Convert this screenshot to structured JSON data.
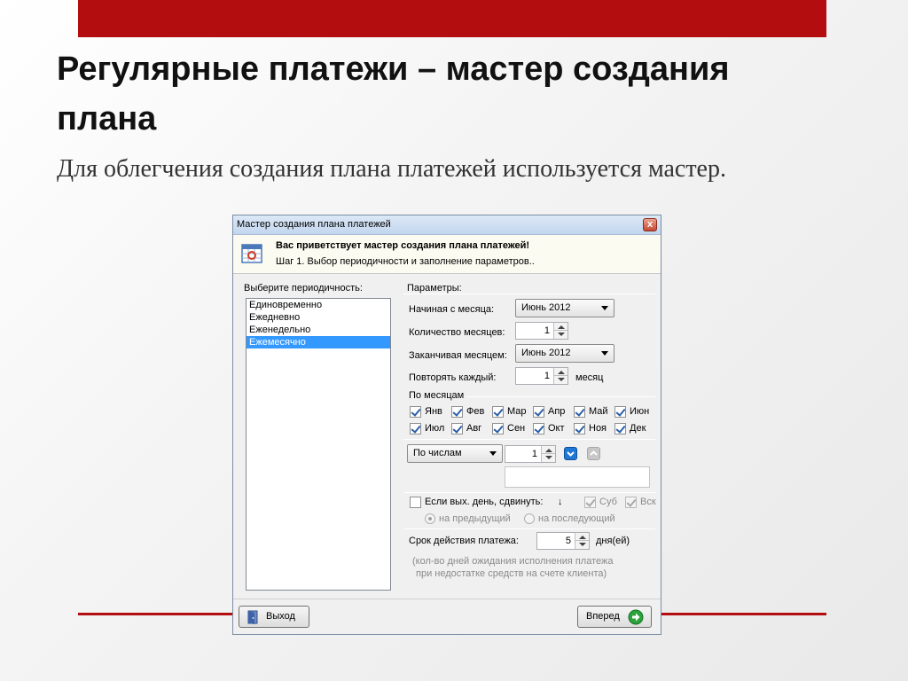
{
  "slide": {
    "title": "Регулярные платежи – мастер создания плана",
    "text": "Для облегчения создания плана платежей используется мастер."
  },
  "dialog": {
    "title": "Мастер создания плана платежей",
    "close_symbol": "x",
    "header_icon": "calendar-icon",
    "header_title": "Вас приветствует мастер создания плана платежей!",
    "header_subtitle": "Шаг 1. Выбор периодичности и заполнение параметров..",
    "periodicity_label": "Выберите периодичность:",
    "periodicity_options": [
      "Единовременно",
      "Ежедневно",
      "Еженедельно",
      "Ежемесячно"
    ],
    "periodicity_selected": "Ежемесячно",
    "params_label": "Параметры:",
    "start_month_label": "Начиная с месяца:",
    "start_month_value": "Июнь 2012",
    "months_count_label": "Количество месяцев:",
    "months_count_value": "1",
    "end_month_label": "Заканчивая месяцем:",
    "end_month_value": "Июнь 2012",
    "repeat_label": "Повторять каждый:",
    "repeat_value": "1",
    "repeat_unit": "месяц",
    "by_months_label": "По месяцам",
    "months": [
      {
        "label": "Янв",
        "checked": true
      },
      {
        "label": "Фев",
        "checked": true
      },
      {
        "label": "Мар",
        "checked": true
      },
      {
        "label": "Апр",
        "checked": true
      },
      {
        "label": "Май",
        "checked": true
      },
      {
        "label": "Июн",
        "checked": true
      },
      {
        "label": "Июл",
        "checked": true
      },
      {
        "label": "Авг",
        "checked": true
      },
      {
        "label": "Сен",
        "checked": true
      },
      {
        "label": "Окт",
        "checked": true
      },
      {
        "label": "Ноя",
        "checked": true
      },
      {
        "label": "Дек",
        "checked": true
      }
    ],
    "by_dates_value": "По числам",
    "day_value": "1",
    "shift_label": "Если вых. день, сдвинуть:",
    "shift_arrow": "↓",
    "sat_label": "Суб",
    "sun_label": "Вск",
    "prev_label": "на предыдущий",
    "next_label": "на последующий",
    "term_label": "Срок действия платежа:",
    "term_value": "5",
    "term_unit": "дня(ей)",
    "note_line1": "(кол-во дней ожидания исполнения платежа",
    "note_line2": "при недостатке средств на счете клиента)",
    "exit_button": "Выход",
    "next_button": "Вперед"
  },
  "colors": {
    "accent_red": "#b30d0f",
    "selection_blue": "#3399ff"
  }
}
